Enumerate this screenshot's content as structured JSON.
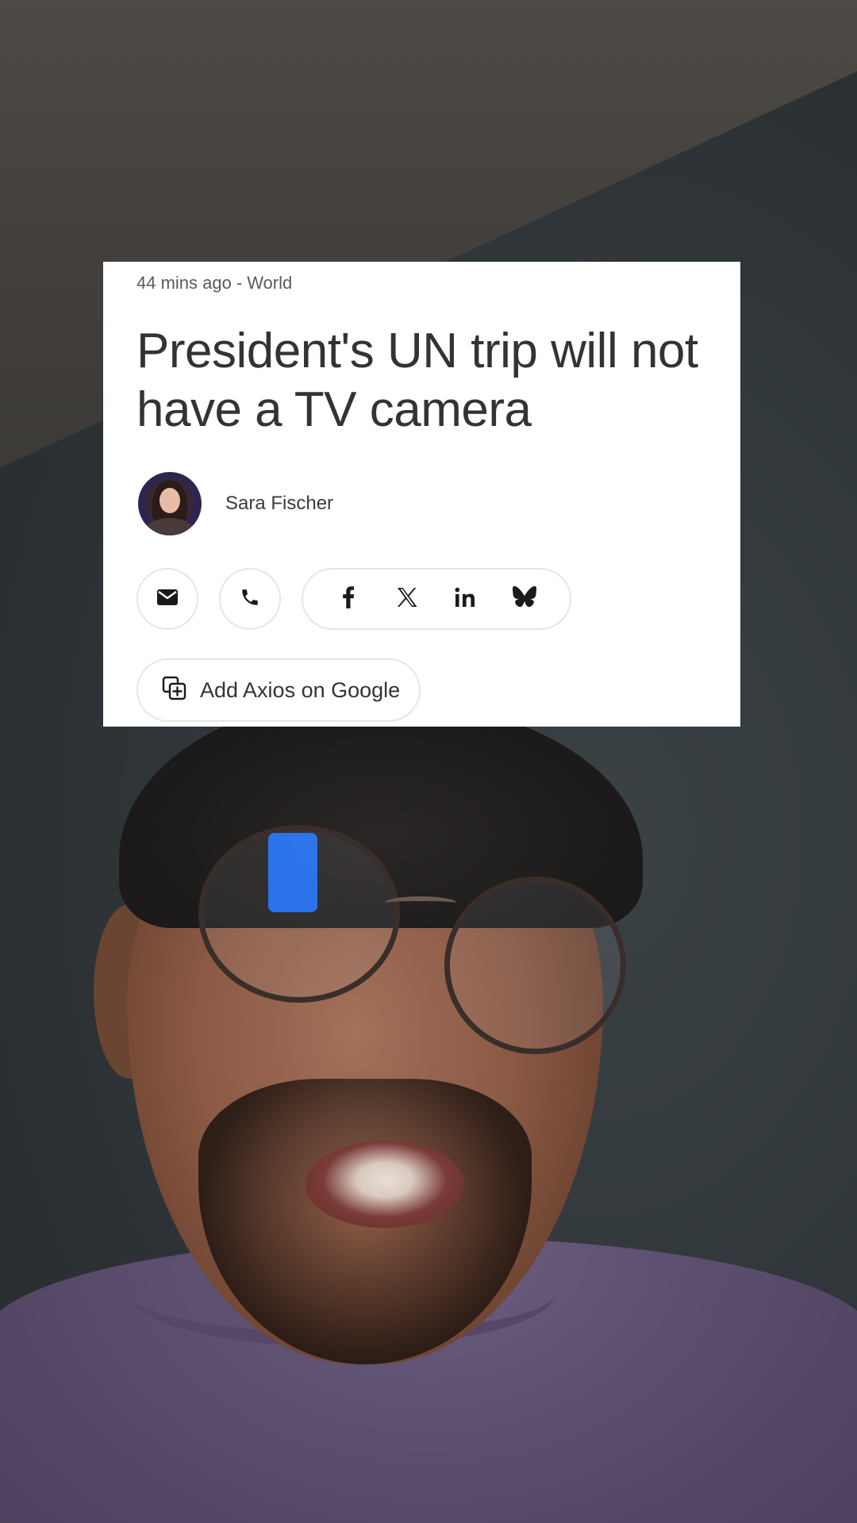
{
  "article": {
    "meta": {
      "timestamp": "44 mins ago",
      "separator": "-",
      "section": "World"
    },
    "headline": "President's UN trip will not have a TV camera",
    "author": {
      "name": "Sara Fischer"
    },
    "share": {
      "buttons": [
        {
          "icon": "email-icon"
        },
        {
          "icon": "phone-icon"
        }
      ],
      "social": [
        {
          "icon": "facebook-icon"
        },
        {
          "icon": "x-icon"
        },
        {
          "icon": "linkedin-icon"
        },
        {
          "icon": "bluesky-icon"
        }
      ]
    },
    "add_source_button": {
      "label": "Add Axios on Google",
      "icon": "add-source-icon"
    }
  },
  "colors": {
    "card_background": "#ffffff",
    "headline_text": "#333333",
    "meta_text": "#5a5a5a",
    "button_border": "#e6e6e6",
    "reflection_blue": "#2a7bff"
  }
}
